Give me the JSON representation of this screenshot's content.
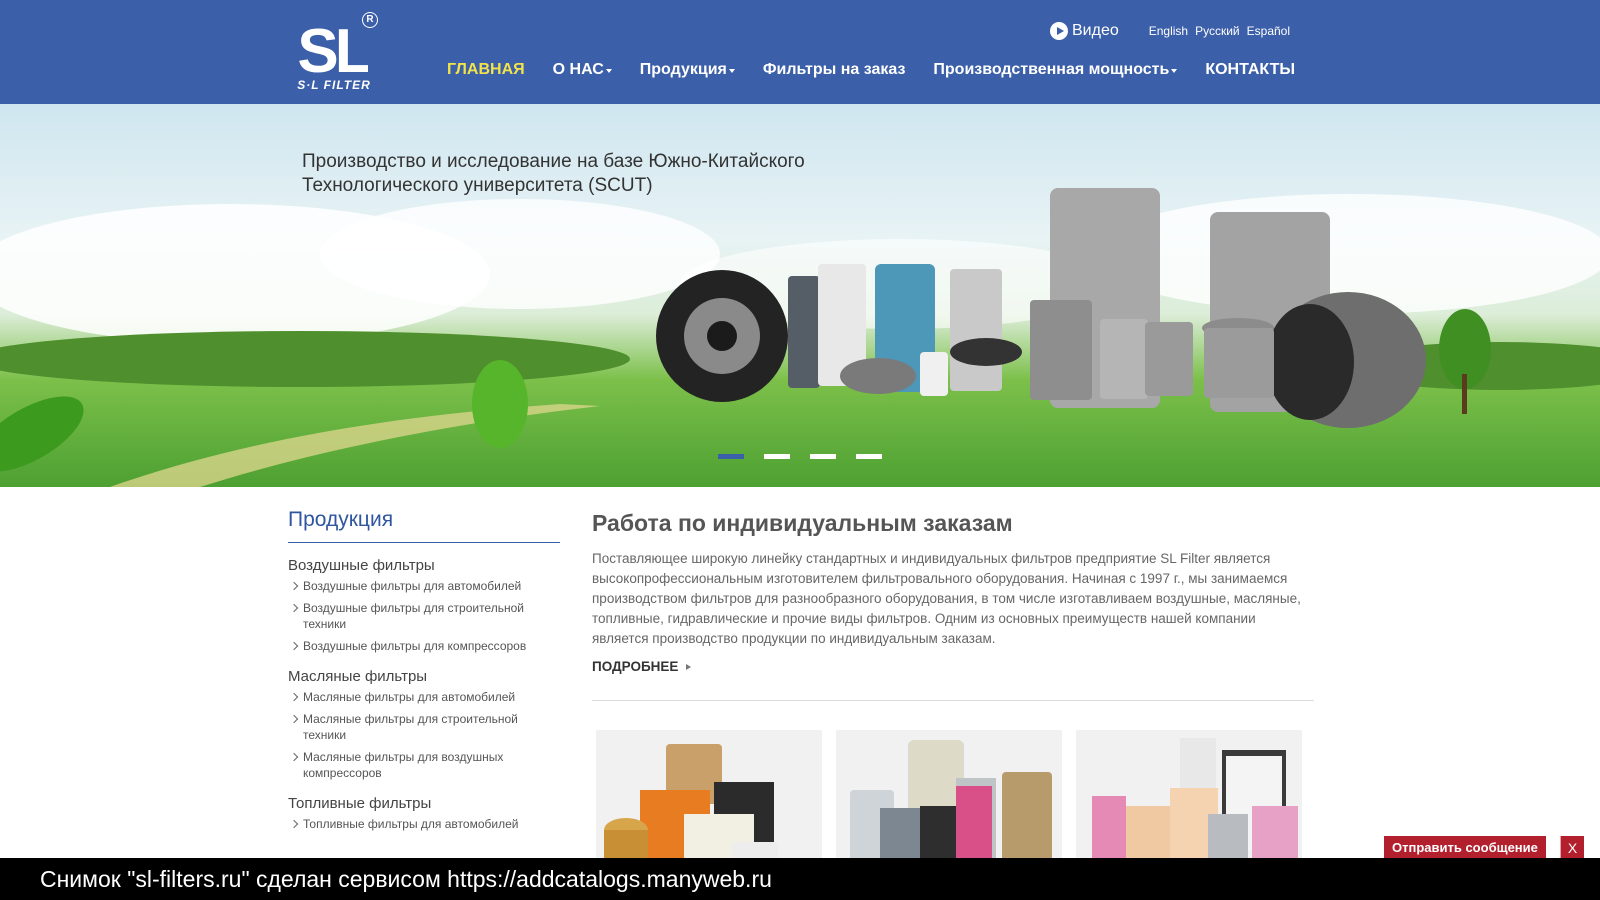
{
  "header": {
    "logo_text": "S·L FILTER",
    "logo_mark": "SL",
    "logo_reg": "R",
    "video_label": "Видео",
    "languages": [
      "English",
      "Русский",
      "Español"
    ],
    "nav": [
      {
        "label": "ГЛАВНАЯ",
        "active": true,
        "dropdown": false
      },
      {
        "label": "О НАС",
        "active": false,
        "dropdown": true
      },
      {
        "label": "Продукция",
        "active": false,
        "dropdown": true
      },
      {
        "label": "Фильтры на заказ",
        "active": false,
        "dropdown": false
      },
      {
        "label": "Производственная мощность",
        "active": false,
        "dropdown": true
      },
      {
        "label": "КОНТАКТЫ",
        "active": false,
        "dropdown": false
      }
    ]
  },
  "hero": {
    "caption_line1": "Производство и исследование на базе Южно-Китайского",
    "caption_line2": "Технологического университета (SCUT)",
    "slides": 4,
    "active_slide": 0
  },
  "sidebar": {
    "title": "Продукция",
    "categories": [
      {
        "title": "Воздушные фильтры",
        "items": [
          "Воздушные фильтры для автомобилей",
          "Воздушные фильтры для строительной техники",
          "Воздушные фильтры для компрессоров"
        ]
      },
      {
        "title": "Масляные фильтры",
        "items": [
          "Масляные фильтры для автомобилей",
          "Масляные фильтры для строительной техники",
          "Масляные фильтры для воздушных компрессоров"
        ]
      },
      {
        "title": "Топливные фильтры",
        "items": [
          "Топливные фильтры для автомобилей"
        ]
      }
    ]
  },
  "main": {
    "title": "Работа по индивидуальным заказам",
    "text": "Поставляющее широкую линейку стандартных и индивидуальных фильтров предприятие SL Filter является высокопрофессиональным изготовителем фильтровального оборудования. Начиная с 1997 г., мы занимаемся производством фильтров для разнообразного оборудования, в том числе изготавливаем воздушные, масляные, топливные, гидравлические и прочие виды фильтров. Одним из основных преимуществ нашей компании является производство продукции по индивидуальным заказам.",
    "more_label": "ПОДРОБНЕЕ"
  },
  "footer": {
    "send_message": "Отправить сообщение",
    "close_label": "X",
    "watermark": "Снимок \"sl-filters.ru\" сделан сервисом https://addcatalogs.manyweb.ru"
  },
  "colors": {
    "header_bg": "#3b5fa8",
    "nav_active": "#f2e34b",
    "accent_blue": "#2f56a0",
    "send_button": "#b21f2d"
  }
}
